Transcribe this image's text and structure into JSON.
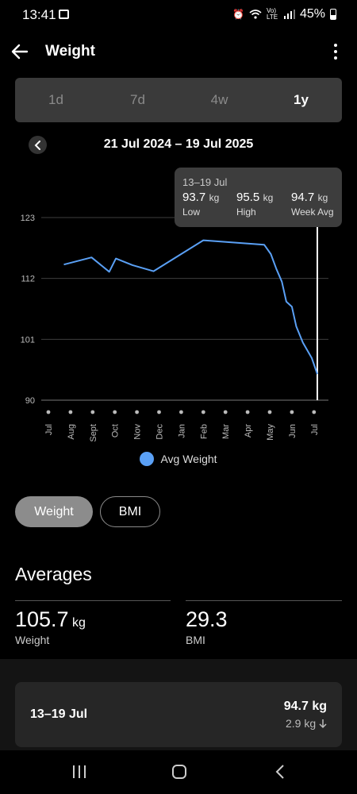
{
  "status_bar": {
    "time": "13:41",
    "volte": "Vo) LTE",
    "battery": "45%",
    "icons": [
      "gallery-icon",
      "alarm-icon",
      "wifi-icon",
      "signal-icon",
      "battery-icon"
    ]
  },
  "app_bar": {
    "title": "Weight"
  },
  "range_tabs": [
    {
      "label": "1d",
      "active": false
    },
    {
      "label": "7d",
      "active": false
    },
    {
      "label": "4w",
      "active": false
    },
    {
      "label": "1y",
      "active": true
    }
  ],
  "date_range": "21 Jul 2024 – 19 Jul 2025",
  "tooltip": {
    "range": "13–19 Jul",
    "low": {
      "value": "93.7",
      "unit": "kg",
      "label": "Low"
    },
    "high": {
      "value": "95.5",
      "unit": "kg",
      "label": "High"
    },
    "avg": {
      "value": "94.7",
      "unit": "kg",
      "label": "Week Avg"
    }
  },
  "chart_data": {
    "type": "line",
    "y_ticks": [
      "123",
      "112",
      "101",
      "90"
    ],
    "ylim": [
      90,
      123
    ],
    "x_tick_labels": [
      "Jul",
      "Aug",
      "Sept",
      "Oct",
      "Nov",
      "Dec",
      "Jan",
      "Feb",
      "Mar",
      "Apr",
      "May",
      "Jun",
      "Jul"
    ],
    "series": [
      {
        "name": "Avg Weight",
        "color": "#5aa0f5",
        "points": [
          [
            0.7,
            114.5
          ],
          [
            1.95,
            115.8
          ],
          [
            2.75,
            113.2
          ],
          [
            3.05,
            115.6
          ],
          [
            3.8,
            114.4
          ],
          [
            4.75,
            113.3
          ],
          [
            7.0,
            118.9
          ],
          [
            9.75,
            118.1
          ],
          [
            10.05,
            116.4
          ],
          [
            10.3,
            113.7
          ],
          [
            10.55,
            111.4
          ],
          [
            10.75,
            107.8
          ],
          [
            11.0,
            106.9
          ],
          [
            11.2,
            103.3
          ],
          [
            11.5,
            100.4
          ],
          [
            11.9,
            97.6
          ],
          [
            12.15,
            94.7
          ]
        ]
      }
    ],
    "highlight_x": 12.15,
    "grid": true,
    "legend_position": "bottom"
  },
  "metric_toggle": [
    {
      "label": "Weight",
      "active": true
    },
    {
      "label": "BMI",
      "active": false
    }
  ],
  "averages": {
    "title": "Averages",
    "weight": {
      "value": "105.7",
      "unit": "kg",
      "label": "Weight"
    },
    "bmi": {
      "value": "29.3",
      "label": "BMI"
    }
  },
  "week_card": {
    "range": "13–19 Jul",
    "value": "94.7 kg",
    "change": "2.9 kg",
    "change_direction": "down"
  }
}
